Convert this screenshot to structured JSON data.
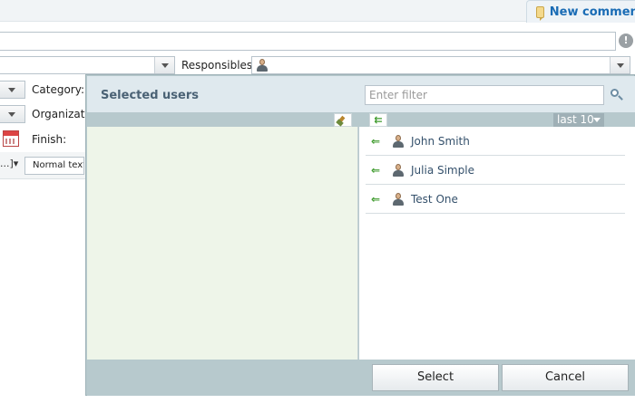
{
  "header": {
    "new_comment_label": "New comment"
  },
  "form": {
    "responsibles_label": "Responsibles:",
    "category_label": "Category:",
    "organization_label": "Organization",
    "finish_label": "Finish:",
    "editor": {
      "more_button": "...",
      "style_value": "Normal text"
    }
  },
  "popup": {
    "title": "Selected users",
    "filter_placeholder": "Enter filter",
    "recent_dropdown": "last 10",
    "users": [
      {
        "name": "John Smith"
      },
      {
        "name": "Julia Simple"
      },
      {
        "name": "Test One"
      }
    ],
    "select_label": "Select",
    "cancel_label": "Cancel"
  },
  "icons": {
    "comment": "comment-icon",
    "info": "info-icon",
    "user": "user-icon",
    "calendar": "calendar-icon",
    "search": "search-icon",
    "clear": "clear-brush-icon",
    "add": "arrow-left-icon"
  },
  "colors": {
    "accent": "#1a6cb5",
    "popup_bg": "#b7c9cd",
    "left_pane_bg": "#eef5e9"
  }
}
